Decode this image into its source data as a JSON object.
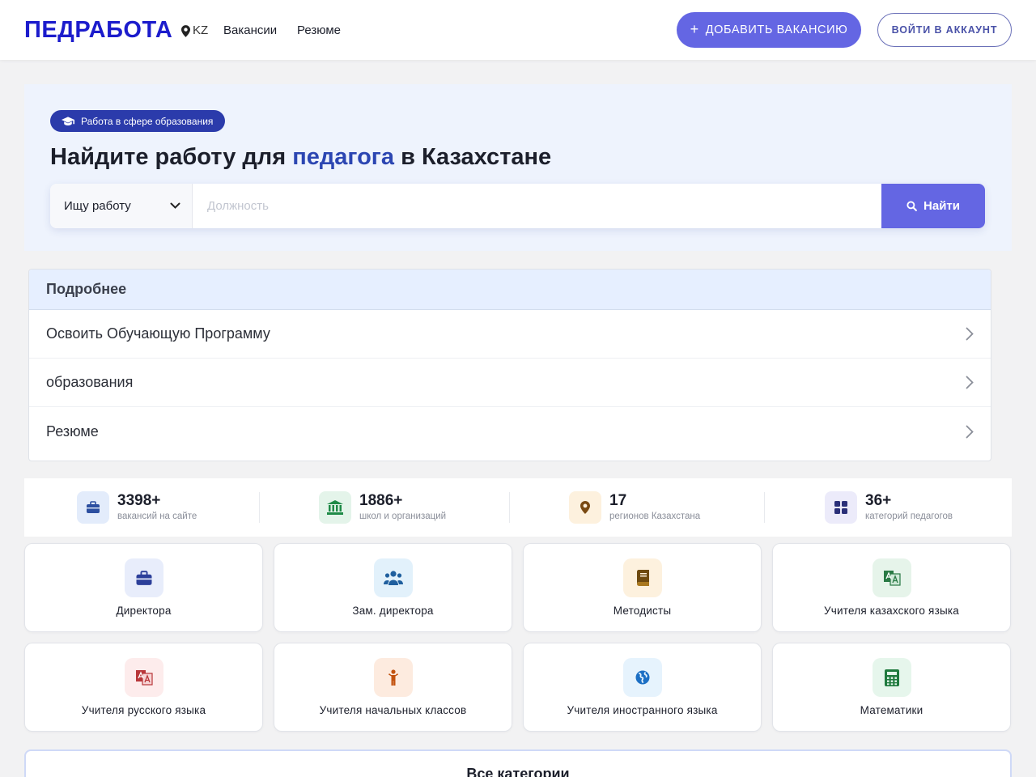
{
  "header": {
    "logo": "ПЕДРАБОТА",
    "region": "KZ",
    "nav": [
      "Вакансии",
      "Резюме"
    ],
    "add_button": "ДОБАВИТЬ ВАКАНСИЮ",
    "login_button": "ВОЙТИ В АККАУНТ"
  },
  "hero": {
    "badge": "Работа в сфере образования",
    "title_before": "Найдите работу для ",
    "title_accent": "педагога",
    "title_after": " в Казахстане",
    "select_value": "Ищу работу",
    "search_placeholder": "Должность",
    "search_button": "Найти"
  },
  "accordion": {
    "title": "Подробнее",
    "items": [
      "Освоить Обучающую Программу",
      "образования",
      "Резюме"
    ]
  },
  "stats": [
    {
      "value": "3398+",
      "label": "вакансий на сайте",
      "icon": "briefcase-icon"
    },
    {
      "value": "1886+",
      "label": "школ и организаций",
      "icon": "school-building-icon"
    },
    {
      "value": "17",
      "label": "регионов Казахстана",
      "icon": "map-pin-icon"
    },
    {
      "value": "36+",
      "label": "категорий педагогов",
      "icon": "grid-icon"
    }
  ],
  "categories": [
    {
      "label": "Директора",
      "icon": "briefcase-icon"
    },
    {
      "label": "Зам. директора",
      "icon": "users-icon"
    },
    {
      "label": "Методисты",
      "icon": "book-icon"
    },
    {
      "label": "Учителя казахского языка",
      "icon": "translate-icon"
    },
    {
      "label": "Учителя русского языка",
      "icon": "translate-icon"
    },
    {
      "label": "Учителя начальных классов",
      "icon": "child-icon"
    },
    {
      "label": "Учителя иностранного языка",
      "icon": "globe-icon"
    },
    {
      "label": "Математики",
      "icon": "calculator-icon"
    }
  ],
  "all_categories": "Все категории",
  "colors": {
    "brand": "#1c1ccc",
    "primary": "#6466e3",
    "accent_text": "#2c46b2",
    "hero_bg": "#eef3fd"
  }
}
